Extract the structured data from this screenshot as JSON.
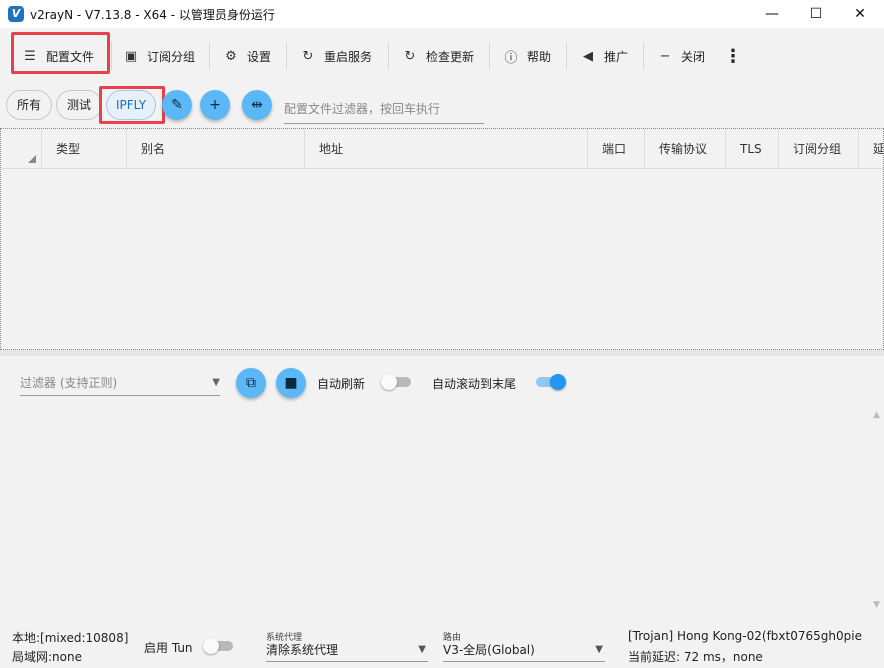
{
  "window": {
    "title": "v2rayN - V7.13.8 - X64 - 以管理员身份运行",
    "minimize_glyph": "—",
    "maximize_glyph": "☐",
    "close_glyph": "✕"
  },
  "toolbar": {
    "items": [
      {
        "label": "配置文件",
        "icon": "server-icon"
      },
      {
        "label": "订阅分组",
        "icon": "subscription-icon"
      },
      {
        "label": "设置",
        "icon": "gear-icon"
      },
      {
        "label": "重启服务",
        "icon": "restart-icon"
      },
      {
        "label": "检查更新",
        "icon": "update-icon"
      },
      {
        "label": "帮助",
        "icon": "help-icon"
      },
      {
        "label": "推广",
        "icon": "speaker-icon"
      },
      {
        "label": "关闭",
        "icon": "minus-icon"
      }
    ],
    "more_glyph": "⋮"
  },
  "filter_chips": [
    {
      "label": "所有",
      "selected": false
    },
    {
      "label": "测试",
      "selected": false
    },
    {
      "label": "IPFLY",
      "selected": true
    }
  ],
  "profile_filter": {
    "placeholder": "配置文件过滤器，按回车执行"
  },
  "table": {
    "columns": [
      "类型",
      "别名",
      "地址",
      "端口",
      "传输协议",
      "TLS",
      "订阅分组",
      "延迟"
    ]
  },
  "log_panel": {
    "filter_placeholder": "过滤器 (支持正则)",
    "auto_refresh_label": "自动刷新",
    "auto_refresh": false,
    "auto_scroll_label": "自动滚动到末尾",
    "auto_scroll": true
  },
  "status": {
    "local": "本地:[mixed:10808]",
    "lan": "局域网:none",
    "tun_label": "启用 Tun",
    "tun_enabled": false,
    "system_proxy_caption": "系统代理",
    "system_proxy_value": "清除系统代理",
    "routing_caption": "路由",
    "routing_value": "V3-全局(Global)",
    "server": "[Trojan] Hong Kong-02(fbxt0765gh0pie",
    "latency": "当前延迟: 72 ms，none"
  },
  "colors": {
    "highlight": "#e8414b",
    "accent": "#2196f3",
    "fab": "#5bb7f5"
  }
}
